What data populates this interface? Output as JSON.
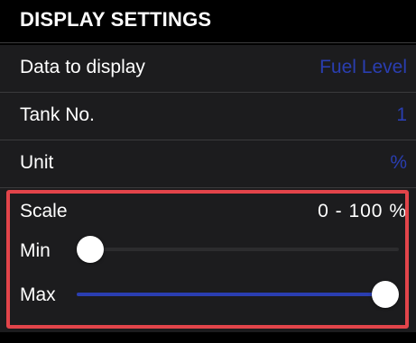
{
  "header": {
    "title": "DISPLAY SETTINGS"
  },
  "rows": {
    "data_to_display": {
      "label": "Data to display",
      "value": "Fuel Level"
    },
    "tank_no": {
      "label": "Tank No.",
      "value": "1"
    },
    "unit": {
      "label": "Unit",
      "value": "%"
    }
  },
  "scale": {
    "label": "Scale",
    "range_text": "0  -  100  %",
    "min": {
      "label": "Min",
      "value_fraction": 0.0
    },
    "max": {
      "label": "Max",
      "value_fraction": 1.0
    }
  },
  "colors": {
    "background": "#000000",
    "row_background": "#1c1c1e",
    "accent": "#2a3eb1",
    "highlight_border": "#e2444a",
    "text": "#ffffff"
  }
}
